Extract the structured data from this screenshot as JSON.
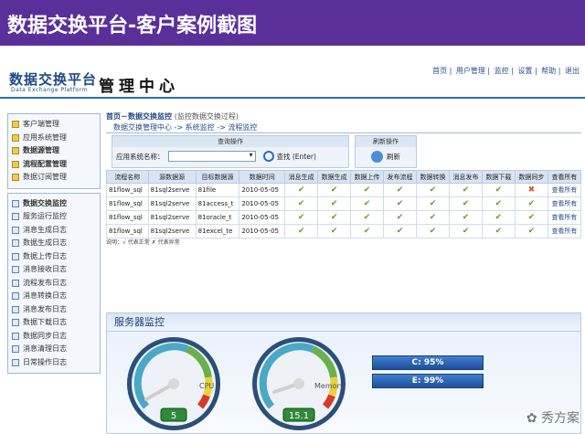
{
  "slide_title": "数据交换平台-客户案例截图",
  "header": {
    "logo_cn": "数据交换平台",
    "logo_en": "Data Exchange Platform",
    "title": "管理中心",
    "nav": [
      "首页",
      "用户管理",
      "监控",
      "设置",
      "帮助",
      "退出"
    ]
  },
  "sidebar": {
    "group1": [
      {
        "label": "客户端管理",
        "bold": false
      },
      {
        "label": "应用系统管理",
        "bold": false
      },
      {
        "label": "数据源管理",
        "bold": true
      },
      {
        "label": "流程配置管理",
        "bold": true
      },
      {
        "label": "数据订阅管理",
        "bold": false
      }
    ],
    "group2": [
      {
        "label": "数据交换监控",
        "bold": true
      },
      {
        "label": "服务运行监控",
        "bold": false
      },
      {
        "label": "消息生成日志",
        "bold": false
      },
      {
        "label": "数据生成日志",
        "bold": false
      },
      {
        "label": "数据上传日志",
        "bold": false
      },
      {
        "label": "消息接收日志",
        "bold": false
      },
      {
        "label": "流程发布日志",
        "bold": false
      },
      {
        "label": "消息转换日志",
        "bold": false
      },
      {
        "label": "消息发布日志",
        "bold": false
      },
      {
        "label": "数据下载日志",
        "bold": false
      },
      {
        "label": "数据同步日志",
        "bold": false
      },
      {
        "label": "消息清理日志",
        "bold": false
      },
      {
        "label": "日常操作日志",
        "bold": false
      }
    ]
  },
  "main": {
    "crumb1": "首页－数据交换监控",
    "crumb1_note": "(监控数据交换过程)",
    "crumb2": "数据交换管理中心 -> 系统监控 -> 流程监控",
    "query_head": "查询操作",
    "query_label": "应用系统名称：",
    "search_label": "查找 (Enter)",
    "refresh_head": "刷新操作",
    "refresh_label": "刷新",
    "columns": [
      "流程名称",
      "源数据源",
      "目标数据源",
      "数据时间",
      "消息生成",
      "数据生成",
      "数据上传",
      "发布流程",
      "数据转换",
      "消息发布",
      "数据下载",
      "数据同步",
      "查看所有"
    ],
    "rows": [
      {
        "name": "81flow_sql",
        "src": "81sql2serve",
        "dst": "81file",
        "time": "2010-05-05",
        "status": [
          "ok",
          "ok",
          "ok",
          "ok",
          "ok",
          "ok",
          "ok",
          "warn"
        ],
        "link": "查看所有"
      },
      {
        "name": "81flow_sql",
        "src": "81sql2serve",
        "dst": "81access_t",
        "time": "2010-05-05",
        "status": [
          "ok",
          "ok",
          "ok",
          "ok",
          "ok",
          "ok",
          "ok",
          "ok"
        ],
        "link": "查看所有"
      },
      {
        "name": "81flow_sql",
        "src": "81sql2serve",
        "dst": "81oracle_t",
        "time": "2010-05-05",
        "status": [
          "ok",
          "ok",
          "ok",
          "ok",
          "ok",
          "ok",
          "ok",
          "ok"
        ],
        "link": "查看所有"
      },
      {
        "name": "81flow_sql",
        "src": "81sql2serve",
        "dst": "81excel_te",
        "time": "2010-05-05",
        "status": [
          "ok",
          "ok",
          "ok",
          "ok",
          "ok",
          "ok",
          "ok",
          "ok"
        ],
        "link": "查看所有"
      }
    ],
    "legend": "说明：√ 代表正常  ✗ 代表异常"
  },
  "monitor": {
    "title": "服务器监控",
    "gauge1": {
      "label": "CPU",
      "value": "5",
      "level": 5
    },
    "gauge2": {
      "label": "Memory",
      "value": "15.1",
      "level": 15.1
    },
    "disk_c": "C: 95%",
    "disk_e": "E: 99%"
  },
  "watermark": "秀方案",
  "colors": {
    "slide_bar": "#5b2f9a",
    "brand_blue": "#1f4a87",
    "ok": "#5aa02c",
    "warn": "#d9532b"
  }
}
